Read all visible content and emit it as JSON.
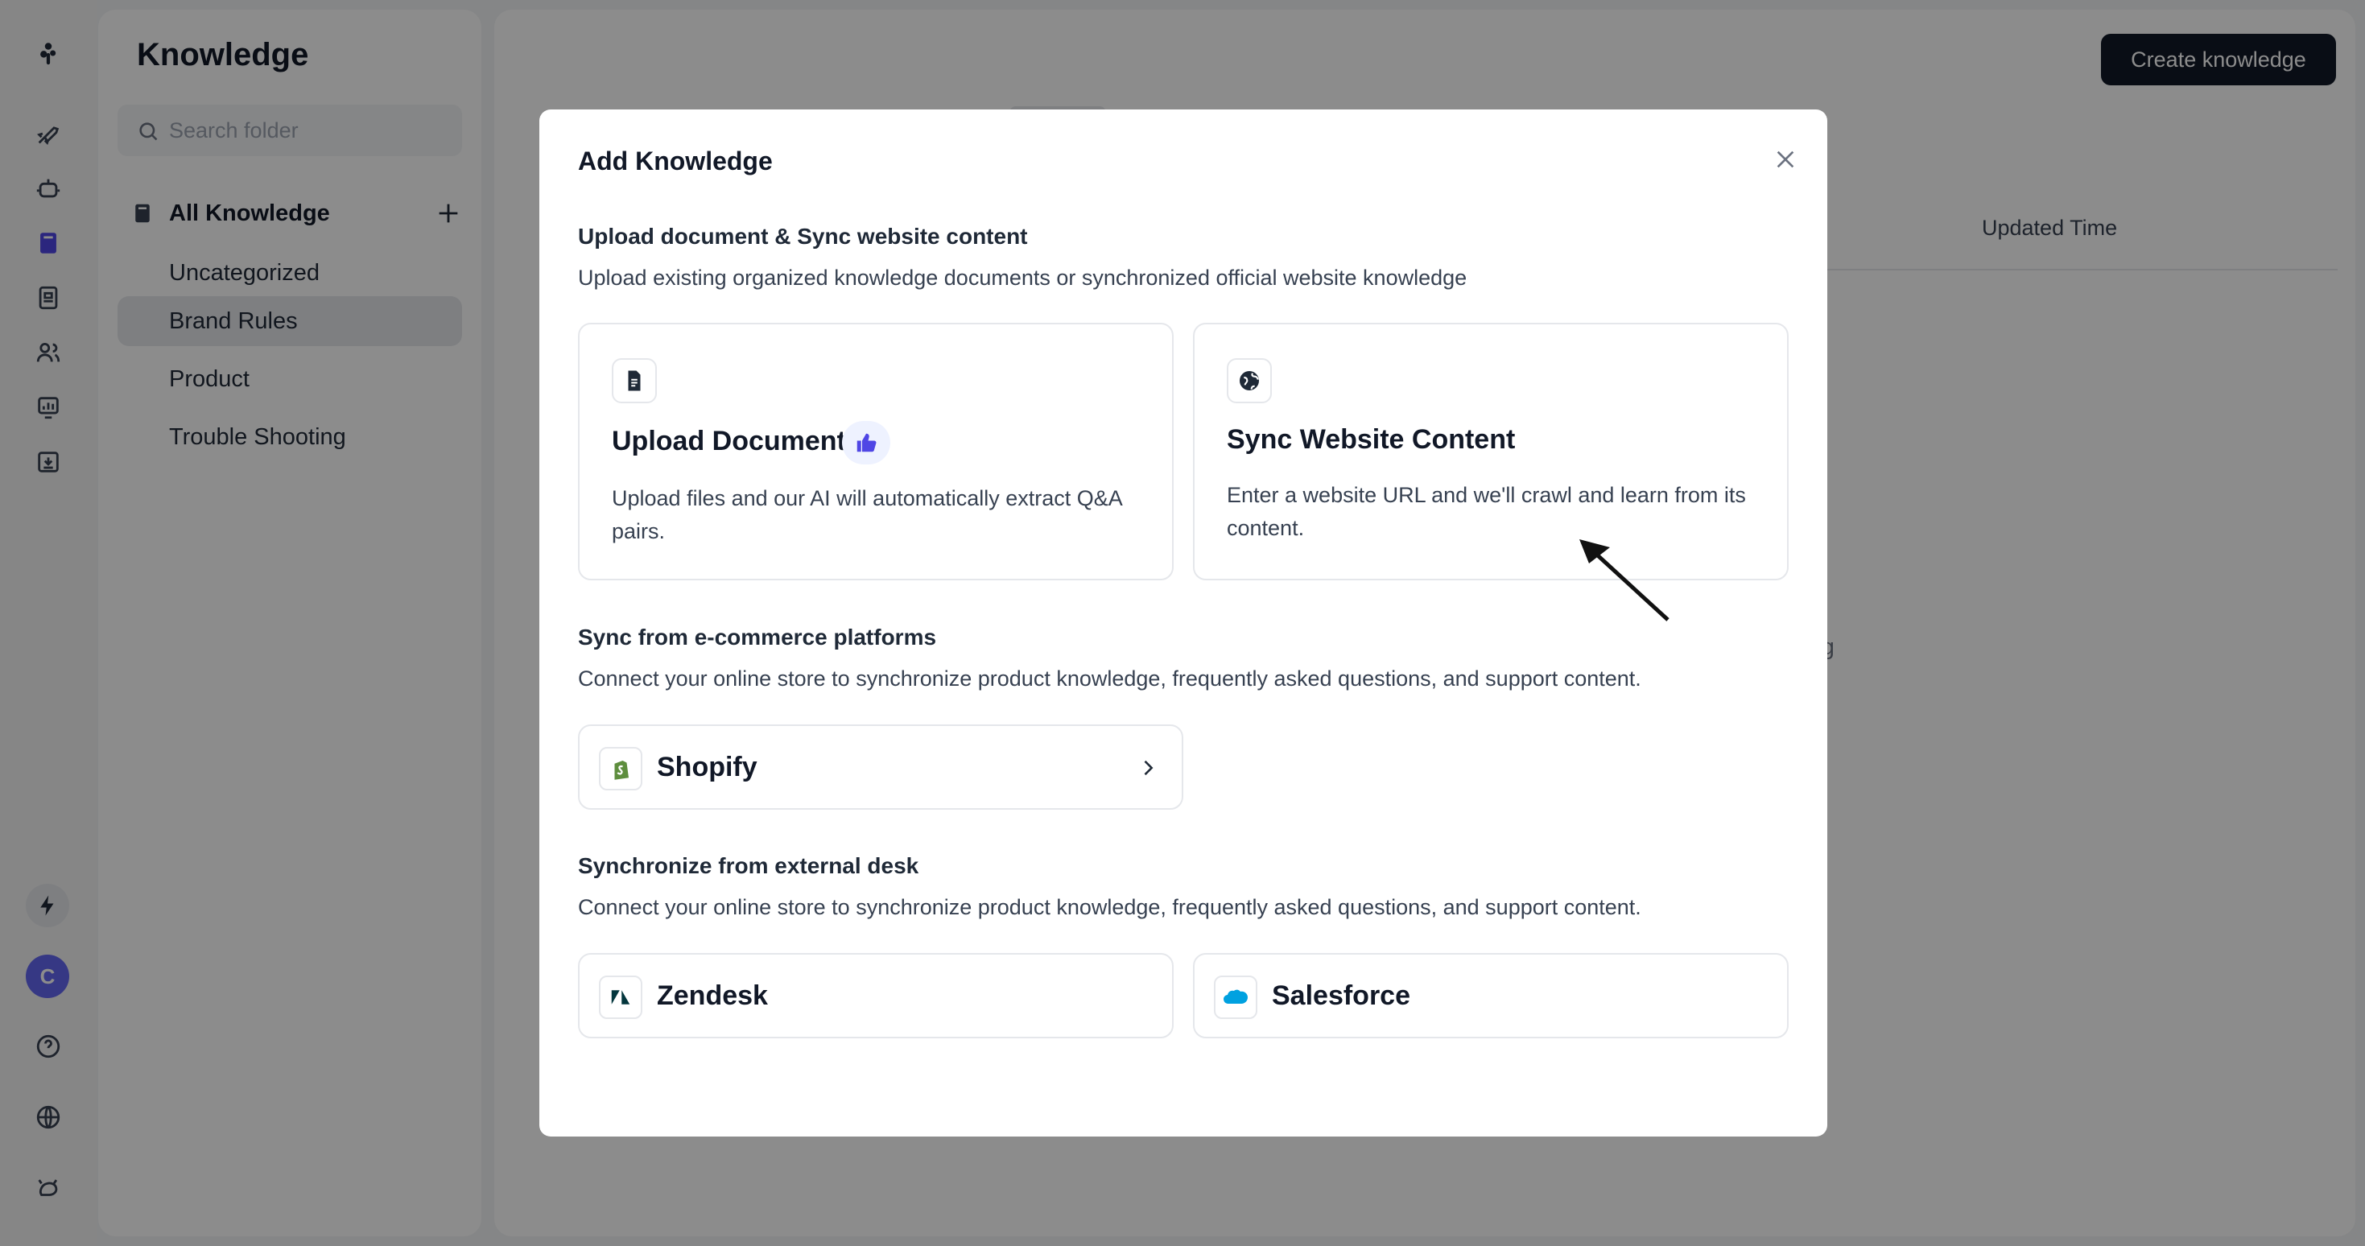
{
  "sidebar": {
    "title": "Knowledge",
    "search_placeholder": "Search folder",
    "all_label": "All Knowledge",
    "folders": [
      {
        "label": "Uncategorized",
        "selected": false
      },
      {
        "label": "Brand Rules",
        "selected": true
      },
      {
        "label": "Product",
        "selected": false
      },
      {
        "label": "Trouble Shooting",
        "selected": false
      }
    ]
  },
  "rail": {
    "icons": [
      "launch-icon",
      "bot-icon",
      "knowledge-book-icon",
      "inbox-icon",
      "users-icon",
      "analytics-icon",
      "archive-icon"
    ],
    "avatar_initial": "C",
    "bottom_icons": [
      "help-icon",
      "globe-icon",
      "pet-icon"
    ]
  },
  "main": {
    "create_button": "Create knowledge",
    "column_header": "Updated Time",
    "background_text": "ding"
  },
  "modal": {
    "title": "Add Knowledge",
    "section1": {
      "title": "Upload document & Sync website content",
      "desc": "Upload existing organized knowledge documents or synchronized official website knowledge",
      "upload": {
        "title": "Upload Document",
        "desc": "Upload files and our AI will automatically extract Q&A pairs."
      },
      "sync": {
        "title": "Sync Website Content",
        "desc": "Enter a website URL and we'll crawl and learn from its content."
      }
    },
    "section2": {
      "title": "Sync from e-commerce platforms",
      "desc": "Connect your online store to synchronize product knowledge, frequently asked questions, and support content.",
      "providers": [
        {
          "label": "Shopify"
        }
      ]
    },
    "section3": {
      "title": "Synchronize from external desk",
      "desc": "Connect your online store to synchronize product knowledge, frequently asked questions, and support content.",
      "providers": [
        {
          "label": "Zendesk"
        },
        {
          "label": "Salesforce"
        }
      ]
    }
  },
  "colors": {
    "accent": "#4f46e5",
    "dark_button": "#111827",
    "overlay": "rgba(0,0,0,0.45)",
    "shopify_green": "#5e8e3e",
    "salesforce_blue": "#00a1e0"
  }
}
